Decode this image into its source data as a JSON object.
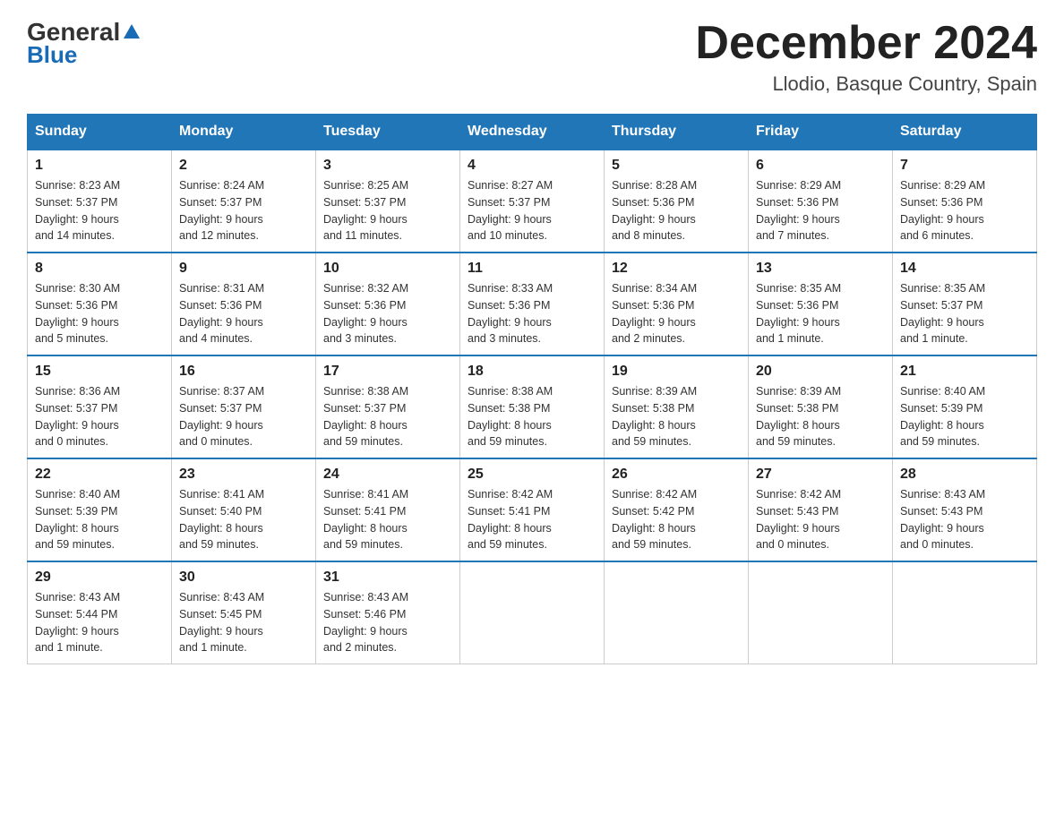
{
  "logo": {
    "general": "General",
    "triangle": "▲",
    "blue": "Blue"
  },
  "header": {
    "title": "December 2024",
    "subtitle": "Llodio, Basque Country, Spain"
  },
  "days_of_week": [
    "Sunday",
    "Monday",
    "Tuesday",
    "Wednesday",
    "Thursday",
    "Friday",
    "Saturday"
  ],
  "weeks": [
    [
      {
        "day": "1",
        "info": "Sunrise: 8:23 AM\nSunset: 5:37 PM\nDaylight: 9 hours\nand 14 minutes."
      },
      {
        "day": "2",
        "info": "Sunrise: 8:24 AM\nSunset: 5:37 PM\nDaylight: 9 hours\nand 12 minutes."
      },
      {
        "day": "3",
        "info": "Sunrise: 8:25 AM\nSunset: 5:37 PM\nDaylight: 9 hours\nand 11 minutes."
      },
      {
        "day": "4",
        "info": "Sunrise: 8:27 AM\nSunset: 5:37 PM\nDaylight: 9 hours\nand 10 minutes."
      },
      {
        "day": "5",
        "info": "Sunrise: 8:28 AM\nSunset: 5:36 PM\nDaylight: 9 hours\nand 8 minutes."
      },
      {
        "day": "6",
        "info": "Sunrise: 8:29 AM\nSunset: 5:36 PM\nDaylight: 9 hours\nand 7 minutes."
      },
      {
        "day": "7",
        "info": "Sunrise: 8:29 AM\nSunset: 5:36 PM\nDaylight: 9 hours\nand 6 minutes."
      }
    ],
    [
      {
        "day": "8",
        "info": "Sunrise: 8:30 AM\nSunset: 5:36 PM\nDaylight: 9 hours\nand 5 minutes."
      },
      {
        "day": "9",
        "info": "Sunrise: 8:31 AM\nSunset: 5:36 PM\nDaylight: 9 hours\nand 4 minutes."
      },
      {
        "day": "10",
        "info": "Sunrise: 8:32 AM\nSunset: 5:36 PM\nDaylight: 9 hours\nand 3 minutes."
      },
      {
        "day": "11",
        "info": "Sunrise: 8:33 AM\nSunset: 5:36 PM\nDaylight: 9 hours\nand 3 minutes."
      },
      {
        "day": "12",
        "info": "Sunrise: 8:34 AM\nSunset: 5:36 PM\nDaylight: 9 hours\nand 2 minutes."
      },
      {
        "day": "13",
        "info": "Sunrise: 8:35 AM\nSunset: 5:36 PM\nDaylight: 9 hours\nand 1 minute."
      },
      {
        "day": "14",
        "info": "Sunrise: 8:35 AM\nSunset: 5:37 PM\nDaylight: 9 hours\nand 1 minute."
      }
    ],
    [
      {
        "day": "15",
        "info": "Sunrise: 8:36 AM\nSunset: 5:37 PM\nDaylight: 9 hours\nand 0 minutes."
      },
      {
        "day": "16",
        "info": "Sunrise: 8:37 AM\nSunset: 5:37 PM\nDaylight: 9 hours\nand 0 minutes."
      },
      {
        "day": "17",
        "info": "Sunrise: 8:38 AM\nSunset: 5:37 PM\nDaylight: 8 hours\nand 59 minutes."
      },
      {
        "day": "18",
        "info": "Sunrise: 8:38 AM\nSunset: 5:38 PM\nDaylight: 8 hours\nand 59 minutes."
      },
      {
        "day": "19",
        "info": "Sunrise: 8:39 AM\nSunset: 5:38 PM\nDaylight: 8 hours\nand 59 minutes."
      },
      {
        "day": "20",
        "info": "Sunrise: 8:39 AM\nSunset: 5:38 PM\nDaylight: 8 hours\nand 59 minutes."
      },
      {
        "day": "21",
        "info": "Sunrise: 8:40 AM\nSunset: 5:39 PM\nDaylight: 8 hours\nand 59 minutes."
      }
    ],
    [
      {
        "day": "22",
        "info": "Sunrise: 8:40 AM\nSunset: 5:39 PM\nDaylight: 8 hours\nand 59 minutes."
      },
      {
        "day": "23",
        "info": "Sunrise: 8:41 AM\nSunset: 5:40 PM\nDaylight: 8 hours\nand 59 minutes."
      },
      {
        "day": "24",
        "info": "Sunrise: 8:41 AM\nSunset: 5:41 PM\nDaylight: 8 hours\nand 59 minutes."
      },
      {
        "day": "25",
        "info": "Sunrise: 8:42 AM\nSunset: 5:41 PM\nDaylight: 8 hours\nand 59 minutes."
      },
      {
        "day": "26",
        "info": "Sunrise: 8:42 AM\nSunset: 5:42 PM\nDaylight: 8 hours\nand 59 minutes."
      },
      {
        "day": "27",
        "info": "Sunrise: 8:42 AM\nSunset: 5:43 PM\nDaylight: 9 hours\nand 0 minutes."
      },
      {
        "day": "28",
        "info": "Sunrise: 8:43 AM\nSunset: 5:43 PM\nDaylight: 9 hours\nand 0 minutes."
      }
    ],
    [
      {
        "day": "29",
        "info": "Sunrise: 8:43 AM\nSunset: 5:44 PM\nDaylight: 9 hours\nand 1 minute."
      },
      {
        "day": "30",
        "info": "Sunrise: 8:43 AM\nSunset: 5:45 PM\nDaylight: 9 hours\nand 1 minute."
      },
      {
        "day": "31",
        "info": "Sunrise: 8:43 AM\nSunset: 5:46 PM\nDaylight: 9 hours\nand 2 minutes."
      },
      null,
      null,
      null,
      null
    ]
  ]
}
